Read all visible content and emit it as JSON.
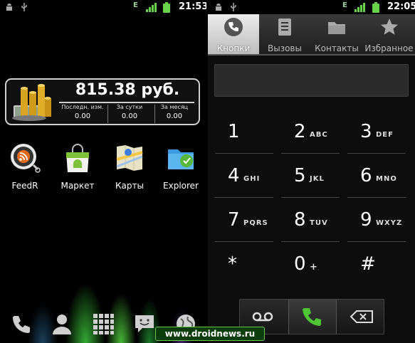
{
  "left_screen": {
    "status": {
      "time": "21:53",
      "network": "E"
    },
    "widget": {
      "amount": "815.38 руб.",
      "stats": [
        {
          "label": "Последн. изм.",
          "value": "0.00"
        },
        {
          "label": "За сутки",
          "value": "0.00"
        },
        {
          "label": "За месяц",
          "value": "0.00"
        }
      ]
    },
    "apps": [
      {
        "label": "FeedR",
        "icon": "rss-icon"
      },
      {
        "label": "Маркет",
        "icon": "market-bag-icon"
      },
      {
        "label": "Карты",
        "icon": "maps-icon"
      },
      {
        "label": "Explorer",
        "icon": "folder-icon"
      }
    ],
    "dock": [
      "phone-icon",
      "contacts-icon",
      "app-grid-icon",
      "messaging-icon",
      "browser-icon"
    ]
  },
  "right_screen": {
    "status": {
      "time": "22:05",
      "network": "E"
    },
    "tabs": [
      {
        "label": "Кнопки",
        "icon": "phone-icon",
        "active": true
      },
      {
        "label": "Вызовы",
        "icon": "call-log-icon",
        "active": false
      },
      {
        "label": "Контакты",
        "icon": "contacts-folder-icon",
        "active": false
      },
      {
        "label": "Избранное",
        "icon": "star-icon",
        "active": false
      }
    ],
    "number_field": {
      "value": ""
    },
    "keys": [
      {
        "num": "1",
        "letters": ""
      },
      {
        "num": "2",
        "letters": "ABC"
      },
      {
        "num": "3",
        "letters": "DEF"
      },
      {
        "num": "4",
        "letters": "GHI"
      },
      {
        "num": "5",
        "letters": "JKL"
      },
      {
        "num": "6",
        "letters": "MNO"
      },
      {
        "num": "7",
        "letters": "PQRS"
      },
      {
        "num": "8",
        "letters": "TUV"
      },
      {
        "num": "9",
        "letters": "WXYZ"
      },
      {
        "num": "*",
        "letters": ""
      },
      {
        "num": "0",
        "letters": "+"
      },
      {
        "num": "#",
        "letters": ""
      }
    ],
    "actions": [
      "voicemail-icon",
      "call-icon",
      "backspace-icon"
    ]
  },
  "watermark": "www.droidnews.ru",
  "colors": {
    "call_green": "#4fc435",
    "battery_green": "#6ad14a",
    "accent_white": "#ffffff"
  }
}
